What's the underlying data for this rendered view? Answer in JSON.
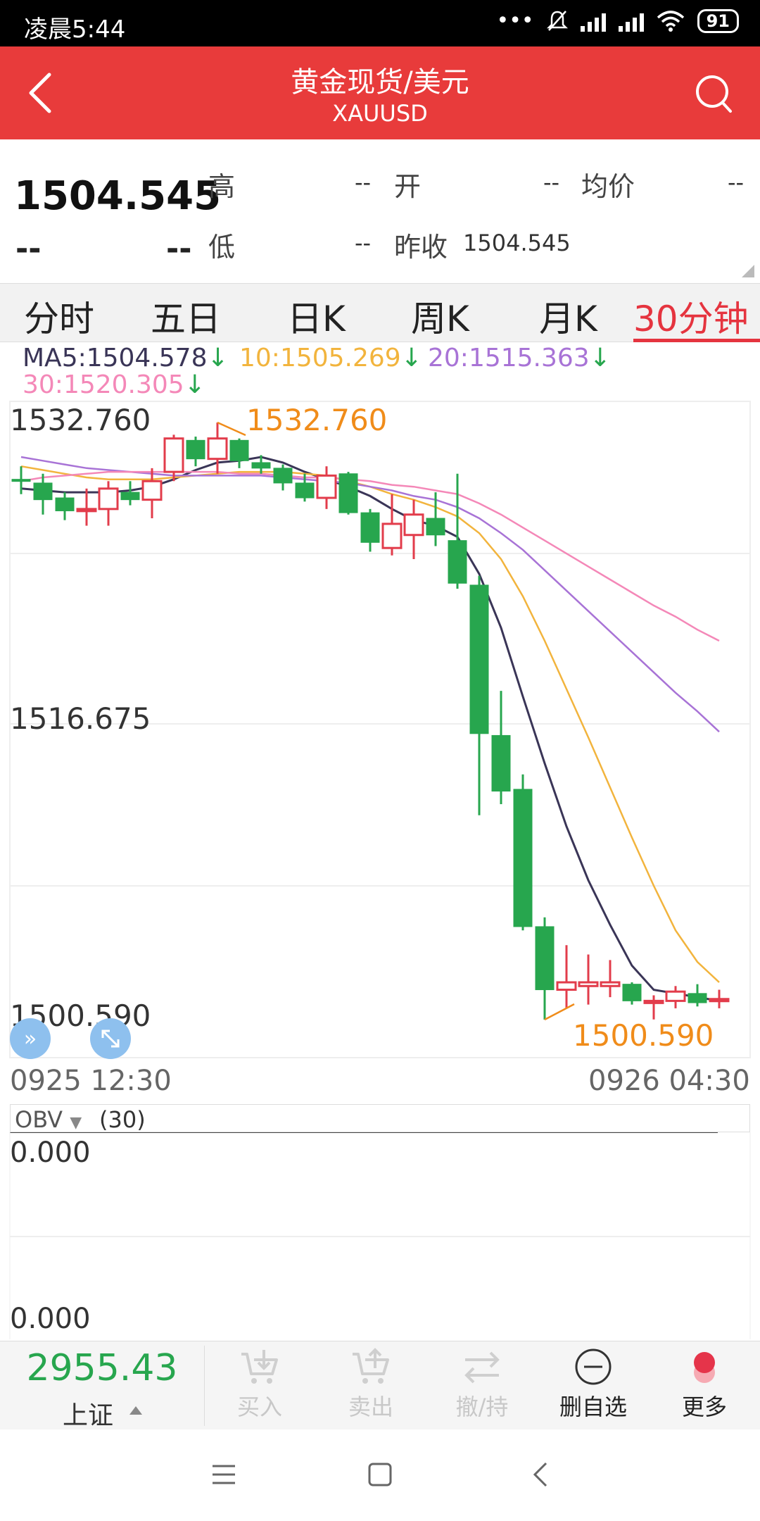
{
  "status_bar": {
    "time": "凌晨5:44",
    "battery": "91"
  },
  "header": {
    "title": "黄金现货/美元",
    "subtitle": "XAUUSD"
  },
  "quote": {
    "price": "1504.545",
    "change": "--",
    "change_pct": "--",
    "fields": {
      "high": {
        "label": "高",
        "value": "--"
      },
      "open": {
        "label": "开",
        "value": "--"
      },
      "avg": {
        "label": "均价",
        "value": "--"
      },
      "low": {
        "label": "低",
        "value": "--"
      },
      "prev_close": {
        "label": "昨收",
        "value": "1504.545"
      }
    }
  },
  "tabs": [
    {
      "label": "分时",
      "active": false
    },
    {
      "label": "五日",
      "active": false
    },
    {
      "label": "日K",
      "active": false
    },
    {
      "label": "周K",
      "active": false
    },
    {
      "label": "月K",
      "active": false
    },
    {
      "label": "30分钟",
      "active": true
    }
  ],
  "ma_legend": {
    "ma5": "MA5:1504.578",
    "ma10": "10:1505.269",
    "ma20": "20:1515.363",
    "ma30": "30:1520.305",
    "arrow": "↓"
  },
  "colors": {
    "up": "#e23c4b",
    "down": "#27a64e",
    "ma5": "#3a3557",
    "ma10": "#f2b43d",
    "ma20": "#a873d6",
    "ma30": "#f488b8",
    "marker": "#f08c1a",
    "header": "#e83b3b"
  },
  "chart_data": {
    "type": "candlestick",
    "y_ticks": [
      "1532.760",
      "1516.675",
      "1500.590"
    ],
    "ylim": [
      1500.59,
      1532.76
    ],
    "x_ticks": [
      "0925 12:30",
      "0926 04:30"
    ],
    "max_marker": "1532.760",
    "min_marker": "1500.590",
    "candles": [
      {
        "o": 1529.7,
        "h": 1530.4,
        "l": 1528.9,
        "c": 1529.6
      },
      {
        "o": 1529.5,
        "h": 1530.0,
        "l": 1527.8,
        "c": 1528.6
      },
      {
        "o": 1528.7,
        "h": 1529.0,
        "l": 1527.5,
        "c": 1528.0
      },
      {
        "o": 1528.0,
        "h": 1529.2,
        "l": 1527.2,
        "c": 1528.1
      },
      {
        "o": 1528.1,
        "h": 1529.6,
        "l": 1527.2,
        "c": 1529.2
      },
      {
        "o": 1529.0,
        "h": 1529.6,
        "l": 1528.3,
        "c": 1528.6
      },
      {
        "o": 1528.6,
        "h": 1530.3,
        "l": 1527.6,
        "c": 1529.6
      },
      {
        "o": 1530.1,
        "h": 1532.1,
        "l": 1529.6,
        "c": 1531.9
      },
      {
        "o": 1531.8,
        "h": 1532.0,
        "l": 1530.4,
        "c": 1530.8
      },
      {
        "o": 1530.8,
        "h": 1532.76,
        "l": 1530.0,
        "c": 1531.9
      },
      {
        "o": 1531.8,
        "h": 1531.9,
        "l": 1530.3,
        "c": 1530.7
      },
      {
        "o": 1530.6,
        "h": 1531.0,
        "l": 1530.0,
        "c": 1530.3
      },
      {
        "o": 1530.3,
        "h": 1530.5,
        "l": 1529.1,
        "c": 1529.5
      },
      {
        "o": 1529.5,
        "h": 1530.0,
        "l": 1528.5,
        "c": 1528.7
      },
      {
        "o": 1528.7,
        "h": 1530.4,
        "l": 1528.1,
        "c": 1529.9
      },
      {
        "o": 1530.0,
        "h": 1530.1,
        "l": 1527.8,
        "c": 1527.9
      },
      {
        "o": 1527.9,
        "h": 1528.1,
        "l": 1525.8,
        "c": 1526.3
      },
      {
        "o": 1526.0,
        "h": 1528.9,
        "l": 1525.6,
        "c": 1527.3
      },
      {
        "o": 1526.7,
        "h": 1528.6,
        "l": 1525.4,
        "c": 1527.8
      },
      {
        "o": 1527.6,
        "h": 1529.0,
        "l": 1526.1,
        "c": 1526.7
      },
      {
        "o": 1526.4,
        "h": 1530.0,
        "l": 1523.8,
        "c": 1524.1
      },
      {
        "o": 1524.0,
        "h": 1524.5,
        "l": 1511.6,
        "c": 1516.0
      },
      {
        "o": 1515.9,
        "h": 1518.3,
        "l": 1512.2,
        "c": 1512.9
      },
      {
        "o": 1513.0,
        "h": 1513.8,
        "l": 1505.4,
        "c": 1505.6
      },
      {
        "o": 1505.6,
        "h": 1506.1,
        "l": 1500.59,
        "c": 1502.2
      },
      {
        "o": 1502.2,
        "h": 1504.6,
        "l": 1501.2,
        "c": 1502.6
      },
      {
        "o": 1502.4,
        "h": 1504.1,
        "l": 1501.4,
        "c": 1502.6
      },
      {
        "o": 1502.4,
        "h": 1503.8,
        "l": 1501.8,
        "c": 1502.6
      },
      {
        "o": 1502.5,
        "h": 1502.6,
        "l": 1501.4,
        "c": 1501.6
      },
      {
        "o": 1501.6,
        "h": 1501.9,
        "l": 1500.6,
        "c": 1501.6
      },
      {
        "o": 1501.6,
        "h": 1502.4,
        "l": 1501.2,
        "c": 1502.1
      },
      {
        "o": 1502.0,
        "h": 1502.5,
        "l": 1501.3,
        "c": 1501.5
      },
      {
        "o": 1501.6,
        "h": 1502.2,
        "l": 1501.2,
        "c": 1501.7
      }
    ],
    "ma_lines": [
      {
        "name": "MA5",
        "start_index": 0,
        "values": [
          1529.2,
          1529.1,
          1529.0,
          1529.0,
          1529.0,
          1529.1,
          1529.3,
          1529.7,
          1530.2,
          1530.6,
          1530.7,
          1530.9,
          1530.6,
          1530.1,
          1529.7,
          1529.3,
          1528.8,
          1528.1,
          1527.5,
          1527.2,
          1526.6,
          1524.6,
          1521.7,
          1518.0,
          1514.4,
          1511.0,
          1508.1,
          1505.7,
          1503.5,
          1502.2,
          1502.0,
          1501.8,
          1501.6
        ]
      },
      {
        "name": "MA10",
        "start_index": 0,
        "values": [
          1530.4,
          1530.2,
          1530.0,
          1529.8,
          1529.7,
          1529.7,
          1529.7,
          1529.8,
          1529.9,
          1530.0,
          1530.1,
          1530.1,
          1530.1,
          1530.0,
          1529.9,
          1529.6,
          1529.3,
          1528.9,
          1528.6,
          1528.2,
          1527.7,
          1526.8,
          1525.4,
          1523.4,
          1521.0,
          1518.4,
          1515.8,
          1513.1,
          1510.4,
          1507.8,
          1505.4,
          1503.7,
          1502.6
        ]
      },
      {
        "name": "MA20",
        "start_index": 0,
        "values": [
          1530.9,
          1530.7,
          1530.5,
          1530.3,
          1530.2,
          1530.1,
          1530.0,
          1529.9,
          1529.9,
          1529.9,
          1529.9,
          1529.9,
          1529.8,
          1529.7,
          1529.6,
          1529.5,
          1529.3,
          1529.1,
          1528.8,
          1528.6,
          1528.2,
          1527.6,
          1526.8,
          1525.9,
          1524.8,
          1523.7,
          1522.6,
          1521.5,
          1520.4,
          1519.3,
          1518.2,
          1517.2,
          1516.1
        ]
      },
      {
        "name": "MA30",
        "start_index": 0,
        "values": [
          1529.6,
          1529.8,
          1529.9,
          1530.0,
          1530.1,
          1530.1,
          1530.1,
          1530.1,
          1530.1,
          1530.1,
          1530.0,
          1530.0,
          1529.9,
          1529.8,
          1529.8,
          1529.7,
          1529.6,
          1529.4,
          1529.3,
          1529.1,
          1528.9,
          1528.4,
          1527.8,
          1527.1,
          1526.4,
          1525.7,
          1525.0,
          1524.3,
          1523.6,
          1522.9,
          1522.3,
          1521.6,
          1521.0
        ]
      }
    ]
  },
  "obv": {
    "selector": "OBV",
    "param": "(30)",
    "y_top": "0.000",
    "y_bottom": "0.000"
  },
  "toolbar": {
    "index_value": "2955.43",
    "index_name": "上证",
    "items": [
      {
        "label": "买入",
        "enabled": false
      },
      {
        "label": "卖出",
        "enabled": false
      },
      {
        "label": "撤/持",
        "enabled": false
      },
      {
        "label": "删自选",
        "enabled": true
      },
      {
        "label": "更多",
        "enabled": true
      }
    ]
  }
}
